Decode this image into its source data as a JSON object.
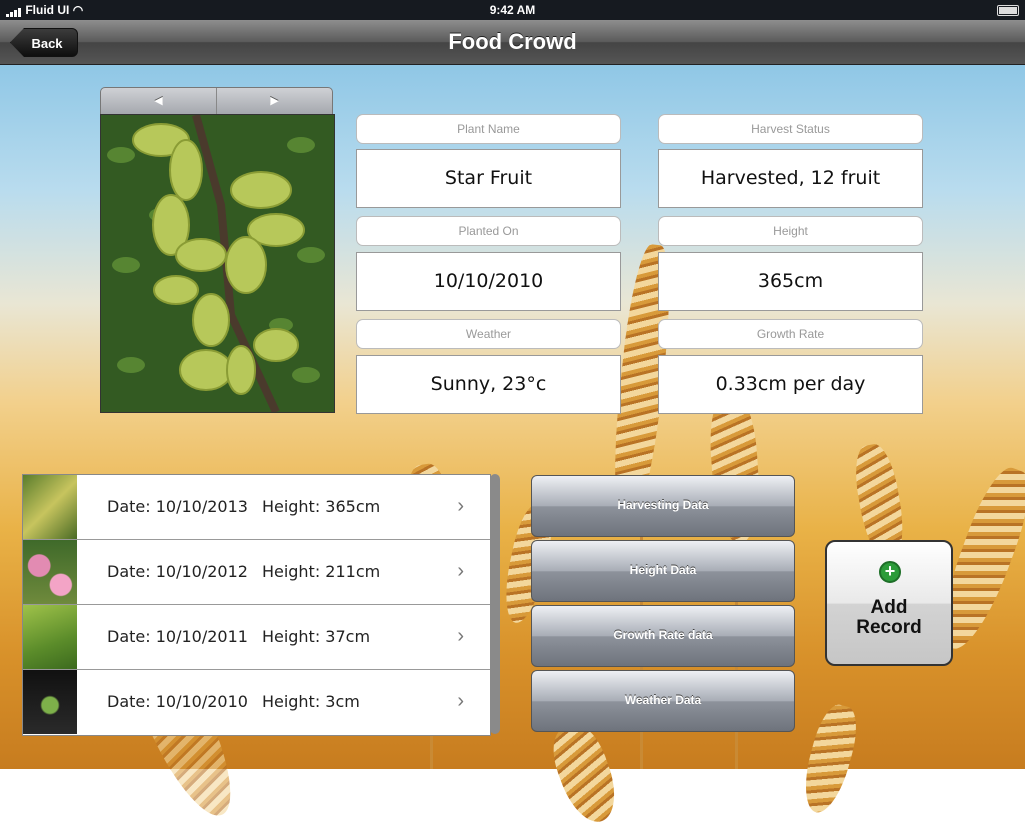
{
  "status_bar": {
    "carrier": "Fluid UI",
    "time": "9:42 AM"
  },
  "nav": {
    "title": "Food Crowd",
    "back_label": "Back"
  },
  "pager": {
    "prev": "◀",
    "next": "▶"
  },
  "fields": {
    "plant_name": {
      "label": "Plant Name",
      "value": "Star Fruit"
    },
    "harvest_status": {
      "label": "Harvest Status",
      "value": "Harvested, 12 fruit"
    },
    "planted_on": {
      "label": "Planted On",
      "value": "10/10/2010"
    },
    "height": {
      "label": "Height",
      "value": "365cm"
    },
    "weather": {
      "label": "Weather",
      "value": "Sunny, 23°c"
    },
    "growth_rate": {
      "label": "Growth Rate",
      "value": "0.33cm per day"
    }
  },
  "records": [
    {
      "date": "Date: 10/10/2013",
      "height": "Height: 365cm"
    },
    {
      "date": "Date: 10/10/2012",
      "height": "Height: 211cm"
    },
    {
      "date": "Date: 10/10/2011",
      "height": "Height: 37cm"
    },
    {
      "date": "Date: 10/10/2010",
      "height": "Height: 3cm"
    }
  ],
  "data_buttons": [
    "Harvesting Data",
    "Height Data",
    "Growth Rate data",
    "Weather Data"
  ],
  "add_record": {
    "icon": "plus-icon",
    "label": "Add Record"
  },
  "colors": {
    "nav": "#555555",
    "accent_green": "#2c9c3a"
  }
}
